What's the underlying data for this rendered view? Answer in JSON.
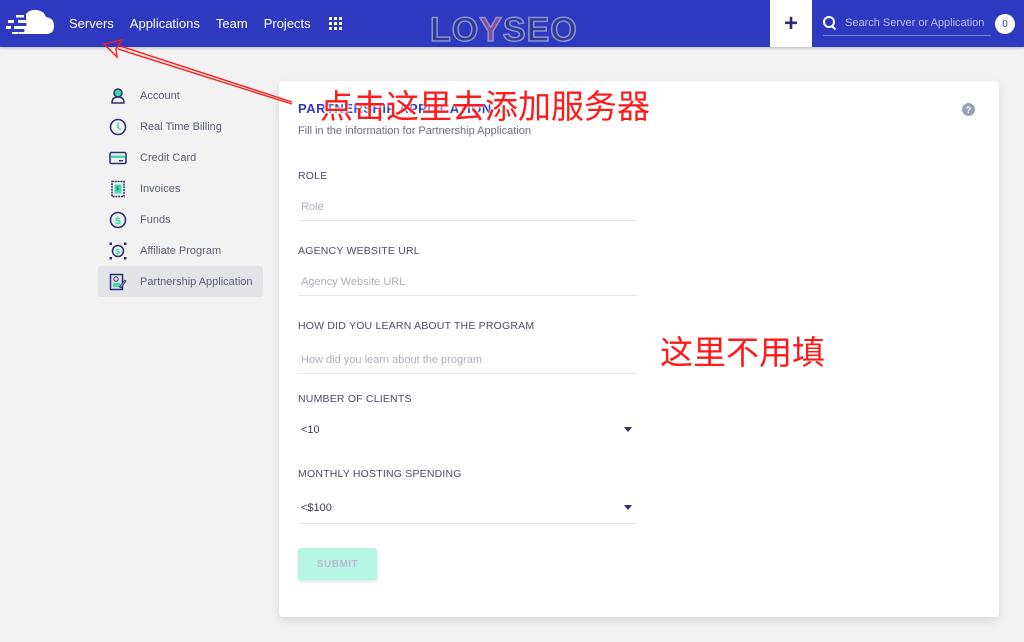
{
  "topbar": {
    "logo": "cloud-logo-icon",
    "nav": [
      "Servers",
      "Applications",
      "Team",
      "Projects"
    ],
    "apps_icon": "grid-icon",
    "watermark": {
      "pre": "LO",
      "mid": "Y",
      "post": "SEO"
    },
    "add_icon": "+",
    "search_placeholder": "Search Server or Application",
    "notification_count": "0"
  },
  "sidebar": {
    "items": [
      {
        "label": "Account",
        "icon": "user-icon",
        "active": false
      },
      {
        "label": "Real Time Billing",
        "icon": "clock-icon",
        "active": false
      },
      {
        "label": "Credit Card",
        "icon": "credit-card-icon",
        "active": false
      },
      {
        "label": "Invoices",
        "icon": "invoice-icon",
        "active": false
      },
      {
        "label": "Funds",
        "icon": "dollar-icon",
        "active": false
      },
      {
        "label": "Affiliate Program",
        "icon": "affiliate-icon",
        "active": false
      },
      {
        "label": "Partnership Application",
        "icon": "certificate-icon",
        "active": true
      }
    ]
  },
  "form": {
    "title": "PARTNERSHIP APPLICATION",
    "subtitle": "Fill in the information for Partnership Application",
    "help_icon": "?",
    "fields": [
      {
        "label": "ROLE",
        "placeholder": "Role",
        "value": ""
      },
      {
        "label": "AGENCY WEBSITE URL",
        "placeholder": "Agency Website URL",
        "value": ""
      },
      {
        "label": "HOW DID YOU LEARN ABOUT THE PROGRAM",
        "placeholder": "How did you learn about the program",
        "value": ""
      }
    ],
    "selects": [
      {
        "label": "NUMBER OF CLIENTS",
        "value": "<10"
      },
      {
        "label": "MONTHLY HOSTING SPENDING",
        "value": "<$100"
      }
    ],
    "submit_label": "SUBMIT"
  },
  "annotations": {
    "click_here": "点击这里去添加服务器",
    "no_need_fill": "这里不用填"
  },
  "colors": {
    "brand": "#2e39bf",
    "accent": "#3ddbb0",
    "annotation": "#ff1a1a"
  }
}
